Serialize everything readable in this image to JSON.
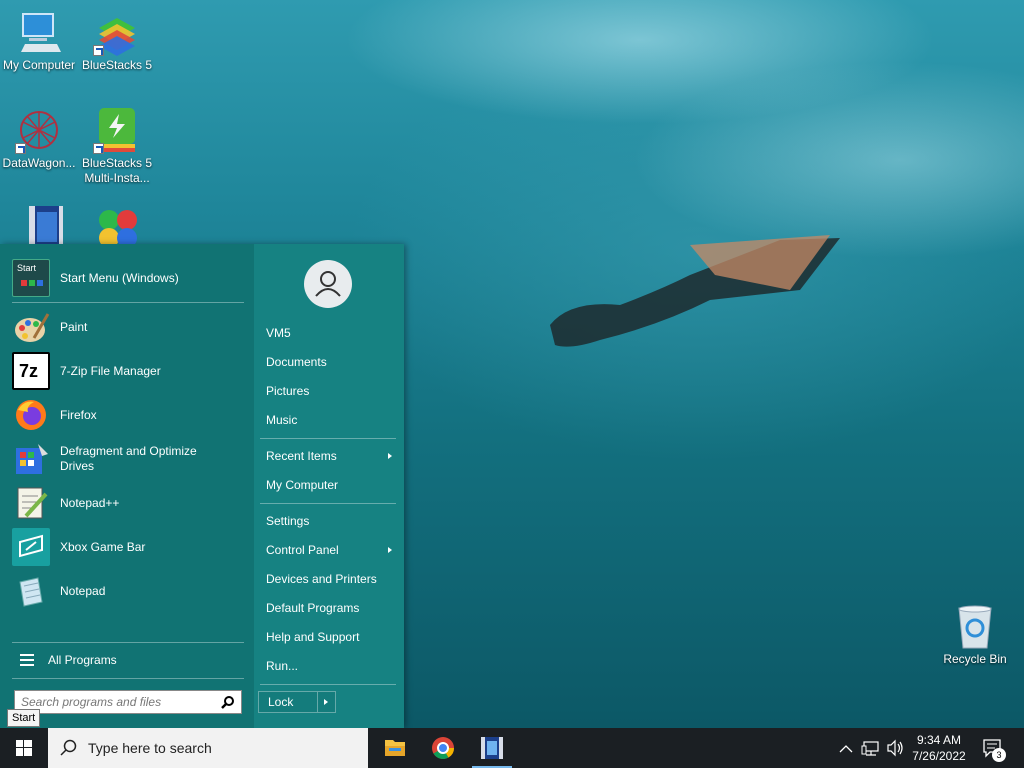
{
  "desktop": {
    "icons": [
      {
        "label": "My Computer",
        "icon": "computer-icon"
      },
      {
        "label": "BlueStacks 5",
        "icon": "bluestacks-icon"
      },
      {
        "label": "DataWagon...",
        "icon": "datawagon-icon"
      },
      {
        "label": "BlueStacks 5 Multi-Insta...",
        "icon": "bluestacks-multi-instance-icon"
      },
      {
        "label": "",
        "icon": "video-file-icon"
      },
      {
        "label": "",
        "icon": "colorful-app-icon"
      },
      {
        "label": "Recycle Bin",
        "icon": "recycle-bin-icon"
      }
    ]
  },
  "start_menu": {
    "header_item": {
      "label": "Start Menu (Windows)",
      "icon": "start-menu-app-icon",
      "icon_text": "Start"
    },
    "programs": [
      {
        "label": "Paint",
        "icon": "paint-icon"
      },
      {
        "label": "7-Zip File Manager",
        "icon": "7zip-icon",
        "icon_text": "7z"
      },
      {
        "label": "Firefox",
        "icon": "firefox-icon"
      },
      {
        "label": "Defragment and Optimize Drives",
        "icon": "defragment-icon"
      },
      {
        "label": "Notepad++",
        "icon": "notepadpp-icon"
      },
      {
        "label": "Xbox Game Bar",
        "icon": "xbox-game-bar-icon"
      },
      {
        "label": "Notepad",
        "icon": "notepad-icon"
      }
    ],
    "all_programs": "All Programs",
    "search_placeholder": "Search programs and files",
    "right": {
      "user": "VM5",
      "group1": [
        "Documents",
        "Pictures",
        "Music"
      ],
      "group2": [
        {
          "label": "Recent Items",
          "submenu": true
        },
        {
          "label": "My Computer",
          "submenu": false
        }
      ],
      "group3": [
        {
          "label": "Settings",
          "submenu": false
        },
        {
          "label": "Control Panel",
          "submenu": true
        },
        {
          "label": "Devices and Printers",
          "submenu": false
        },
        {
          "label": "Default Programs",
          "submenu": false
        },
        {
          "label": "Help and Support",
          "submenu": false
        },
        {
          "label": "Run...",
          "submenu": false
        }
      ],
      "lock": "Lock"
    }
  },
  "tooltip": "Start",
  "taskbar": {
    "search_placeholder": "Type here to search",
    "apps": [
      "file-explorer-icon",
      "chrome-icon",
      "video-app-icon"
    ],
    "time": "9:34 AM",
    "date": "7/26/2022",
    "notification_count": "3"
  },
  "colors": {
    "start_menu_bg": "#117373",
    "start_menu_right_bg": "#168282",
    "taskbar_bg": "#1b1f23",
    "accent": "#76b9ed"
  }
}
